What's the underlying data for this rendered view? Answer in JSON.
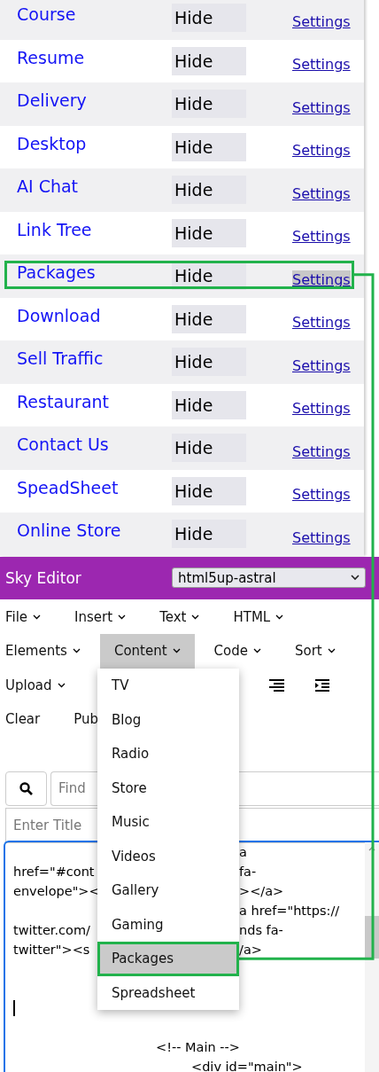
{
  "apps": [
    {
      "name": "Course",
      "hide": "Hide",
      "settings": "Settings",
      "highlighted": false,
      "annotated": false
    },
    {
      "name": "Resume",
      "hide": "Hide",
      "settings": "Settings",
      "highlighted": false,
      "annotated": false
    },
    {
      "name": "Delivery",
      "hide": "Hide",
      "settings": "Settings",
      "highlighted": false,
      "annotated": false
    },
    {
      "name": "Desktop",
      "hide": "Hide",
      "settings": "Settings",
      "highlighted": false,
      "annotated": false
    },
    {
      "name": "AI Chat",
      "hide": "Hide",
      "settings": "Settings",
      "highlighted": false,
      "annotated": false
    },
    {
      "name": "Link Tree",
      "hide": "Hide",
      "settings": "Settings",
      "highlighted": false,
      "annotated": false
    },
    {
      "name": "Packages",
      "hide": "Hide",
      "settings": "Settings",
      "highlighted": true,
      "annotated": true
    },
    {
      "name": "Download",
      "hide": "Hide",
      "settings": "Settings",
      "highlighted": false,
      "annotated": false
    },
    {
      "name": "Sell Traffic",
      "hide": "Hide",
      "settings": "Settings",
      "highlighted": false,
      "annotated": false
    },
    {
      "name": "Restaurant",
      "hide": "Hide",
      "settings": "Settings",
      "highlighted": false,
      "annotated": false
    },
    {
      "name": "Contact Us",
      "hide": "Hide",
      "settings": "Settings",
      "highlighted": false,
      "annotated": false
    },
    {
      "name": "SpeadSheet",
      "hide": "Hide",
      "settings": "Settings",
      "highlighted": false,
      "annotated": false
    },
    {
      "name": "Online Store",
      "hide": "Hide",
      "settings": "Settings",
      "highlighted": false,
      "annotated": false
    }
  ],
  "editor": {
    "title": "Sky Editor",
    "template": "html5up-astral",
    "menu_rows": [
      [
        {
          "label": "File",
          "kind": "menu",
          "selected": false
        },
        {
          "label": "Insert",
          "kind": "menu",
          "selected": false
        },
        {
          "label": "Text",
          "kind": "menu",
          "selected": false
        },
        {
          "label": "HTML",
          "kind": "menu",
          "selected": false
        }
      ],
      [
        {
          "label": "Elements",
          "kind": "menu",
          "selected": false
        },
        {
          "label": "Content",
          "kind": "menu",
          "selected": true
        },
        {
          "label": "Code",
          "kind": "menu",
          "selected": false
        },
        {
          "label": "Sort",
          "kind": "menu",
          "selected": false
        }
      ],
      [
        {
          "label": "Upload",
          "kind": "menu",
          "selected": false
        }
      ],
      [
        {
          "label": "Clear",
          "kind": "button",
          "selected": false
        },
        {
          "label": "Pub",
          "kind": "button",
          "selected": false
        }
      ]
    ],
    "dropdown": [
      {
        "label": "TV",
        "selected": false,
        "annotated": false
      },
      {
        "label": "Blog",
        "selected": false,
        "annotated": false
      },
      {
        "label": "Radio",
        "selected": false,
        "annotated": false
      },
      {
        "label": "Store",
        "selected": false,
        "annotated": false
      },
      {
        "label": "Music",
        "selected": false,
        "annotated": false
      },
      {
        "label": "Videos",
        "selected": false,
        "annotated": false
      },
      {
        "label": "Gallery",
        "selected": false,
        "annotated": false
      },
      {
        "label": "Gaming",
        "selected": false,
        "annotated": false
      },
      {
        "label": "Packages",
        "selected": true,
        "annotated": true
      },
      {
        "label": "Spreadsheet",
        "selected": false,
        "annotated": false
      }
    ],
    "find": {
      "placeholder": "Find"
    },
    "title_field": {
      "placeholder": "Enter Title"
    },
    "code_lines": [
      {
        "kind": "split",
        "right": "a"
      },
      {
        "kind": "split",
        "left": "href=\"#cont",
        "right": "fa-"
      },
      {
        "kind": "split",
        "left": "envelope\"><",
        "right": "></a>"
      },
      {
        "kind": "split",
        "right": "a href=\"https://"
      },
      {
        "kind": "split",
        "left": "twitter.com/",
        "right": "nds fa-"
      },
      {
        "kind": "split",
        "left": "twitter\"><s",
        "right": "/a>"
      },
      {
        "kind": "blank"
      },
      {
        "kind": "blank"
      },
      {
        "kind": "caret"
      },
      {
        "kind": "blank"
      },
      {
        "kind": "outer",
        "text": "<!-- Main -->"
      },
      {
        "kind": "inner",
        "text": "<div id=\"main\">"
      }
    ]
  }
}
